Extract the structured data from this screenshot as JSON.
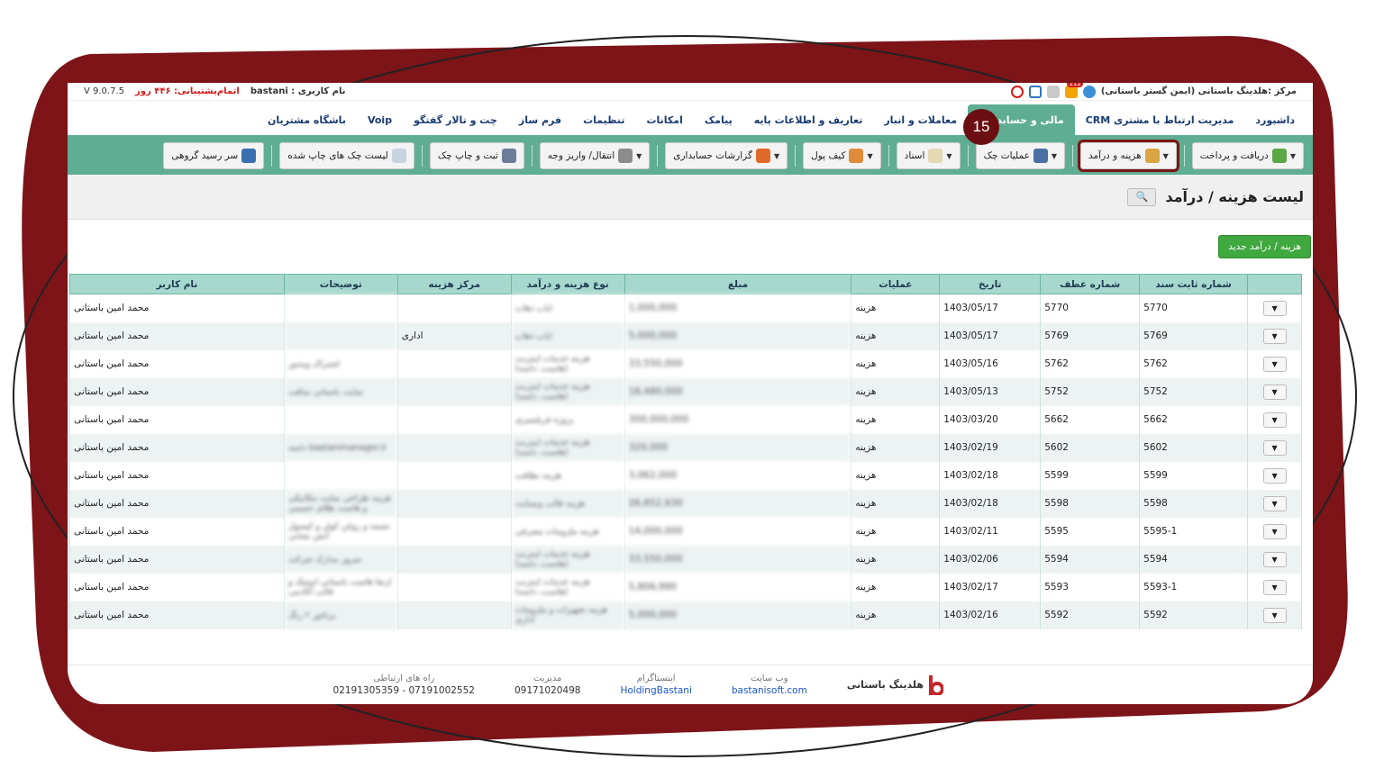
{
  "topbar": {
    "center_label": "مرکز :هلدینگ باستانی (ایمن گستر باستانی)",
    "username_label": "نام کاربری : bastani",
    "support_label": "اتمام‌پشتیبانی: ۴۴۶ روز",
    "version": "V 9.0.7.5",
    "notif_count": "112"
  },
  "menu": [
    "داشبورد",
    "مدیریت ارتباط با مشتری CRM",
    "مالی و حسابداری",
    "معاملات و انبار",
    "تعاریف و اطلاعات پایه",
    "پیامک",
    "امکانات",
    "تنظیمات",
    "فرم ساز",
    "چت و تالار گفتگو",
    "Voip",
    "باشگاه مشتریان"
  ],
  "toolbar": [
    "دریافت و پرداخت",
    "هزینه و درآمد",
    "عملیات چک",
    "اسناد",
    "کیف پول",
    "گزارشات حسابداری",
    "انتقال/ واریز وجه",
    "ثبت و چاپ چک",
    "لیست چک های چاپ شده",
    "سر رسید گروهی"
  ],
  "page_title": "لیست هزینه / درآمد",
  "step_badge": "15",
  "new_button": "هزینه / درآمد جدید",
  "table": {
    "headers": [
      "",
      "شماره ثابت سند",
      "شماره عطف",
      "تاریخ",
      "عملیات",
      "مبلغ",
      "نوع هزینه و درآمد",
      "مرکز هزینه",
      "توضیحات",
      "نام کاربر"
    ],
    "rows": [
      {
        "doc": "5770",
        "ref": "5770",
        "date": "1403/05/17",
        "op": "هزینه",
        "amount": "1,000,000",
        "type": "ایاب ذهاب",
        "center": "",
        "desc": "",
        "user": "محمد امین باستانی"
      },
      {
        "doc": "5769",
        "ref": "5769",
        "date": "1403/05/17",
        "op": "هزینه",
        "amount": "5,000,000",
        "type": "ایاب ذهاب",
        "center": "اداری",
        "desc": "",
        "user": "محمد امین باستانی"
      },
      {
        "doc": "5762",
        "ref": "5762",
        "date": "1403/05/16",
        "op": "هزینه",
        "amount": "33,550,000",
        "type": "هزینه خدمات اینترنت (هاست، دامنه)",
        "center": "",
        "desc": "اشتراک ویندوز",
        "user": "محمد امین باستانی"
      },
      {
        "doc": "5752",
        "ref": "5752",
        "date": "1403/05/13",
        "op": "هزینه",
        "amount": "18,480,000",
        "type": "هزینه خدمات اینترنت (هاست، دامنه)",
        "center": "",
        "desc": "سایت باستانی سافت",
        "user": "محمد امین باستانی"
      },
      {
        "doc": "5662",
        "ref": "5662",
        "date": "1403/03/20",
        "op": "هزینه",
        "amount": "300,000,000",
        "type": "پروژه فریلنسری",
        "center": "",
        "desc": "",
        "user": "محمد امین باستانی"
      },
      {
        "doc": "5602",
        "ref": "5602",
        "date": "1403/02/19",
        "op": "هزینه",
        "amount": "320,000",
        "type": "هزینه خدمات اینترنت (هاست، دامنه)",
        "center": "",
        "desc": "bastanimanager.ir دامنه",
        "user": "محمد امین باستانی"
      },
      {
        "doc": "5599",
        "ref": "5599",
        "date": "1403/02/18",
        "op": "هزینه",
        "amount": "3,062,000",
        "type": "هزینه نظافت",
        "center": "",
        "desc": "",
        "user": "محمد امین باستانی"
      },
      {
        "doc": "5598",
        "ref": "5598",
        "date": "1403/02/18",
        "op": "هزینه",
        "amount": "26,852,930",
        "type": "هزینه قالب وبسایت",
        "center": "",
        "desc": "هزینه طراحی سایت مکانیکی و هاست طلای حسینی",
        "user": "محمد امین باستانی"
      },
      {
        "doc": "5595-1",
        "ref": "5595",
        "date": "1403/02/11",
        "op": "هزینه",
        "amount": "14,000,000",
        "type": "هزینه ملزومات مصرفی",
        "center": "",
        "desc": "تسمه و روغن کولر و کپسول آتش نشانی",
        "user": "محمد امین باستانی"
      },
      {
        "doc": "5594",
        "ref": "5594",
        "date": "1403/02/06",
        "op": "هزینه",
        "amount": "33,550,000",
        "type": "هزینه خدمات اینترنت (هاست، دامنه)",
        "center": "",
        "desc": "سرور مدارک شرکت",
        "user": "محمد امین باستانی"
      },
      {
        "doc": "5593-1",
        "ref": "5593",
        "date": "1403/02/17",
        "op": "هزینه",
        "amount": "5,806,990",
        "type": "هزینه خدمات اینترنت (هاست، دامنه)",
        "center": "",
        "desc": "ارتقا هاست باستانی اینیتیک و قالب آکادمی",
        "user": "محمد امین باستانی"
      },
      {
        "doc": "5592",
        "ref": "5592",
        "date": "1403/02/16",
        "op": "هزینه",
        "amount": "5,000,000",
        "type": "هزینه تجهیزات و ملزومات اداری",
        "center": "",
        "desc": "پرتاتور ۲ رنگ",
        "user": "محمد امین باستانی"
      }
    ]
  },
  "footer": {
    "brand": "هلدینگ باستانی",
    "website_label": "وب سایت",
    "website": "bastanisoft.com",
    "instagram_label": "اینستاگرام",
    "instagram": "HoldingBastani",
    "management_label": "مدیریت",
    "management_phone": "09171020498",
    "contact_label": "راه های ارتباطی",
    "contact_phones": "07191002552 - 02191305359"
  },
  "colors": {
    "accent": "#5fae93",
    "frame": "#6b0f12",
    "header": "#a7d8cd",
    "highlight": "#7a1515"
  }
}
